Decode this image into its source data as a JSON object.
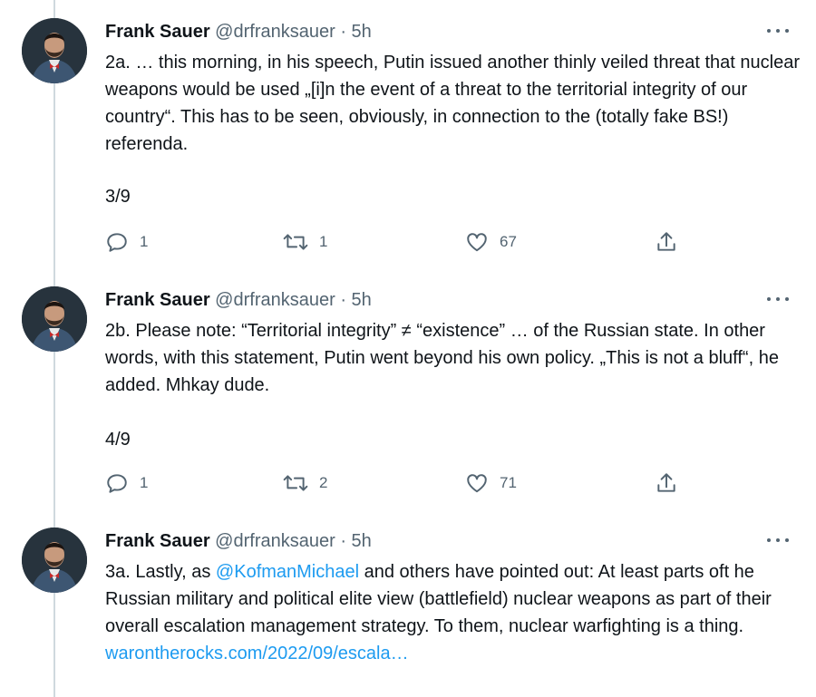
{
  "tweets": [
    {
      "name": "Frank Sauer",
      "handle": "@drfranksauer",
      "time": "5h",
      "text": "2a. … this morning, in his speech, Putin issued another thinly veiled threat that nuclear weapons would be used „[i]n the event of a threat to the territorial integrity of our country“. This has to be seen, obviously, in connection to the (totally fake BS!) referenda.",
      "thread_count": "3/9",
      "replies": "1",
      "retweets": "1",
      "likes": "67"
    },
    {
      "name": "Frank Sauer",
      "handle": "@drfranksauer",
      "time": "5h",
      "text": "2b. Please note: “Territorial integrity” ≠ “existence” … of the Russian state. In other words, with this statement, Putin went beyond his own policy. „This is not a bluff“, he added. Mhkay dude.",
      "thread_count": "4/9",
      "replies": "1",
      "retweets": "2",
      "likes": "71"
    },
    {
      "name": "Frank Sauer",
      "handle": "@drfranksauer",
      "time": "5h",
      "text_before_mention": "3a. Lastly, as ",
      "mention": "@KofmanMichael",
      "text_after_mention": " and others have pointed out: At least parts oft he Russian military and political elite view (battlefield) nuclear weapons as part of their overall escalation management strategy. To them, nuclear warfighting is a thing.",
      "link": "warontherocks.com/2022/09/escala…"
    }
  ],
  "separator": "·",
  "icons": {
    "reply": "reply-icon",
    "retweet": "retweet-icon",
    "like": "heart-icon",
    "share": "share-icon",
    "more": "more-icon"
  },
  "colors": {
    "link": "#1d9bf0",
    "secondary": "#536471",
    "thread_line": "#cfd9de"
  }
}
